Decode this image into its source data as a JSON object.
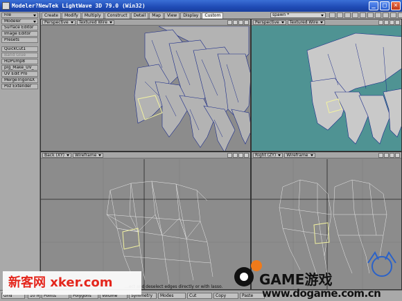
{
  "window": {
    "title": "Modeler?NewTek LightWave 3D 79.0 (Win32)",
    "buttons": {
      "minimize": "_",
      "maximize": "□",
      "close": "✕"
    }
  },
  "left_panel": {
    "items": [
      {
        "label": "File",
        "dropdown": true
      },
      {
        "label": "Modeler",
        "dropdown": true
      },
      {
        "label": "Surface Editor"
      },
      {
        "label": "Image Editor"
      },
      {
        "label": "Presets"
      },
      {
        "label": "QuickCut1"
      },
      {
        "label": "Band Glue",
        "disabled": true
      },
      {
        "label": "HDPump8"
      },
      {
        "label": "plg_Make_UV_"
      },
      {
        "label": "UV Edit Pro"
      },
      {
        "label": "MergeTrigonsX"
      },
      {
        "label": "Poz Extender"
      }
    ]
  },
  "tabs": [
    "Create",
    "Modify",
    "Multiply",
    "Construct",
    "Detail",
    "Map",
    "View",
    "Display",
    "Custom"
  ],
  "active_tab": "Custom",
  "layer_select": "spawn *",
  "viewports": {
    "top_left": {
      "view": "Perspective",
      "mode": "Textured Wire"
    },
    "top_right": {
      "view": "Perspective",
      "mode": "Textured Wire"
    },
    "bottom_left": {
      "view": "Back",
      "axes": "(XY)",
      "mode": "Wireframe"
    },
    "bottom_right": {
      "view": "Right",
      "axes": "(ZY)",
      "mode": "Wireframe"
    }
  },
  "status_message": "...ect and deselect edges directly or with lasso.",
  "bottom_bar": {
    "grid_label": "Grid",
    "grid_value": "10 m",
    "points": "Points",
    "polygons": "Polygons",
    "volume": "Volume",
    "symmetry": "Symmetry",
    "modes": "Modes",
    "cut": "Cut",
    "copy": "Copy",
    "paste": "Paste"
  },
  "watermarks": {
    "left": "新客网 xker.com",
    "game": "GAME游戏",
    "url": "www.dogame.com.cn"
  },
  "colors": {
    "title_bar": "#2453c2",
    "textured_viewport_bg": "#4f9393",
    "viewport_bg": "#8c8c8c",
    "mesh_wire": "#1a2a8a",
    "selected_edge": "#f2f2a0"
  }
}
